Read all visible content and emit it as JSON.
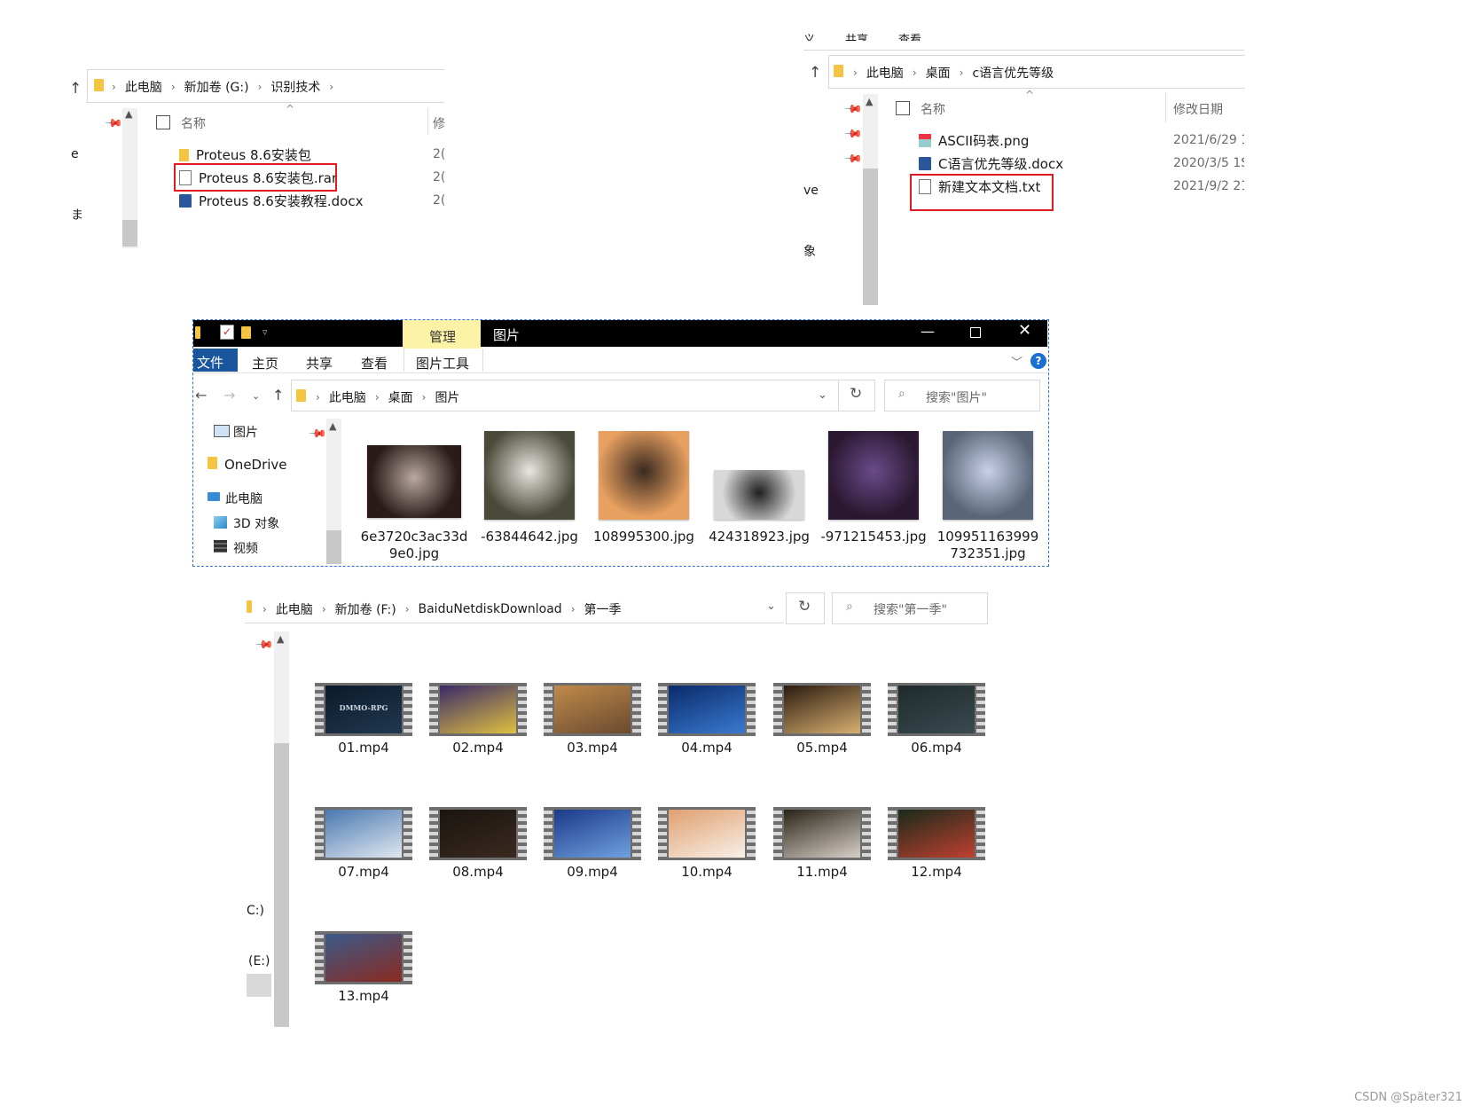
{
  "w1": {
    "breadcrumb": [
      "此电脑",
      "新加卷 (G:)",
      "识别技术"
    ],
    "col_name": "名称",
    "col_date": "修",
    "side": [
      "e",
      "ま"
    ],
    "files": [
      {
        "name": "Proteus 8.6安装包",
        "icon": "folder-icon",
        "date": "2("
      },
      {
        "name": "Proteus 8.6安装包.rar",
        "icon": "file-icon",
        "date": "2("
      },
      {
        "name": "Proteus 8.6安装教程.docx",
        "icon": "docx-icon",
        "date": "2("
      }
    ]
  },
  "w2": {
    "ribbon_partial": [
      "义",
      "共享",
      "查看"
    ],
    "breadcrumb": [
      "此电脑",
      "桌面",
      "c语言优先等级"
    ],
    "col_name": "名称",
    "col_date": "修改日期",
    "side": [
      "ve",
      "象"
    ],
    "files": [
      {
        "name": "ASCII码表.png",
        "icon": "png-icon",
        "date": "2021/6/29 1"
      },
      {
        "name": "C语言优先等级.docx",
        "icon": "docx-icon",
        "date": "2020/3/5 1S"
      },
      {
        "name": "新建文本文档.txt",
        "icon": "txt-icon",
        "date": "2021/9/2 21"
      }
    ]
  },
  "w3": {
    "context_tab": "管理",
    "title": "图片",
    "tabs": [
      "文件",
      "主页",
      "共享",
      "查看",
      "图片工具"
    ],
    "breadcrumb": [
      "此电脑",
      "桌面",
      "图片"
    ],
    "search_placeholder": "搜索\"图片\"",
    "nav": [
      "图片",
      "OneDrive",
      "此电脑",
      "3D 对象",
      "视频"
    ],
    "pictures": [
      {
        "line1": "6e3720c3ac33d",
        "line2": "9e0.jpg",
        "colors": [
          "#2a1a18",
          "#b8a8a0"
        ]
      },
      {
        "line1": "-63844642.jpg",
        "line2": "",
        "colors": [
          "#4a4a3a",
          "#e8e6e0"
        ]
      },
      {
        "line1": "108995300.jpg",
        "line2": "",
        "colors": [
          "#e8a060",
          "#3a2a20"
        ]
      },
      {
        "line1": "424318923.jpg",
        "line2": "",
        "colors": [
          "#d8d8d8",
          "#202020"
        ]
      },
      {
        "line1": "-971215453.jpg",
        "line2": "",
        "colors": [
          "#2a1830",
          "#6a4a8a"
        ]
      },
      {
        "line1": "109951163999",
        "line2": "732351.jpg",
        "colors": [
          "#5a6678",
          "#c8d0e8"
        ]
      }
    ]
  },
  "w4": {
    "breadcrumb": [
      "此电脑",
      "新加卷 (F:)",
      "BaiduNetdiskDownload",
      "第一季"
    ],
    "search_placeholder": "搜索\"第一季\"",
    "side": [
      "C:)",
      "(E:)"
    ],
    "videos": [
      {
        "name": "01.mp4",
        "colors": [
          "#0c1a2a",
          "#203850"
        ],
        "caption": "DMMO-RPG"
      },
      {
        "name": "02.mp4",
        "colors": [
          "#3a2a6a",
          "#e0c040"
        ]
      },
      {
        "name": "03.mp4",
        "colors": [
          "#c08a4a",
          "#6a4a30"
        ]
      },
      {
        "name": "04.mp4",
        "colors": [
          "#0a2a6a",
          "#3a7ad0"
        ]
      },
      {
        "name": "05.mp4",
        "colors": [
          "#2a1a10",
          "#d8b070"
        ]
      },
      {
        "name": "06.mp4",
        "colors": [
          "#1e2a2e",
          "#3a4a4e"
        ]
      },
      {
        "name": "07.mp4",
        "colors": [
          "#4a78b0",
          "#e0e8f0"
        ]
      },
      {
        "name": "08.mp4",
        "colors": [
          "#1a1410",
          "#3a2a20"
        ]
      },
      {
        "name": "09.mp4",
        "colors": [
          "#1a3a8a",
          "#70a0e0"
        ]
      },
      {
        "name": "10.mp4",
        "colors": [
          "#e0a070",
          "#f8f0e8"
        ]
      },
      {
        "name": "11.mp4",
        "colors": [
          "#2a2418",
          "#d8d0c8"
        ]
      },
      {
        "name": "12.mp4",
        "colors": [
          "#1a2a1a",
          "#c04030"
        ]
      },
      {
        "name": "13.mp4",
        "colors": [
          "#3a5a8a",
          "#8a2a20"
        ]
      }
    ]
  },
  "watermark": "CSDN @Später321"
}
